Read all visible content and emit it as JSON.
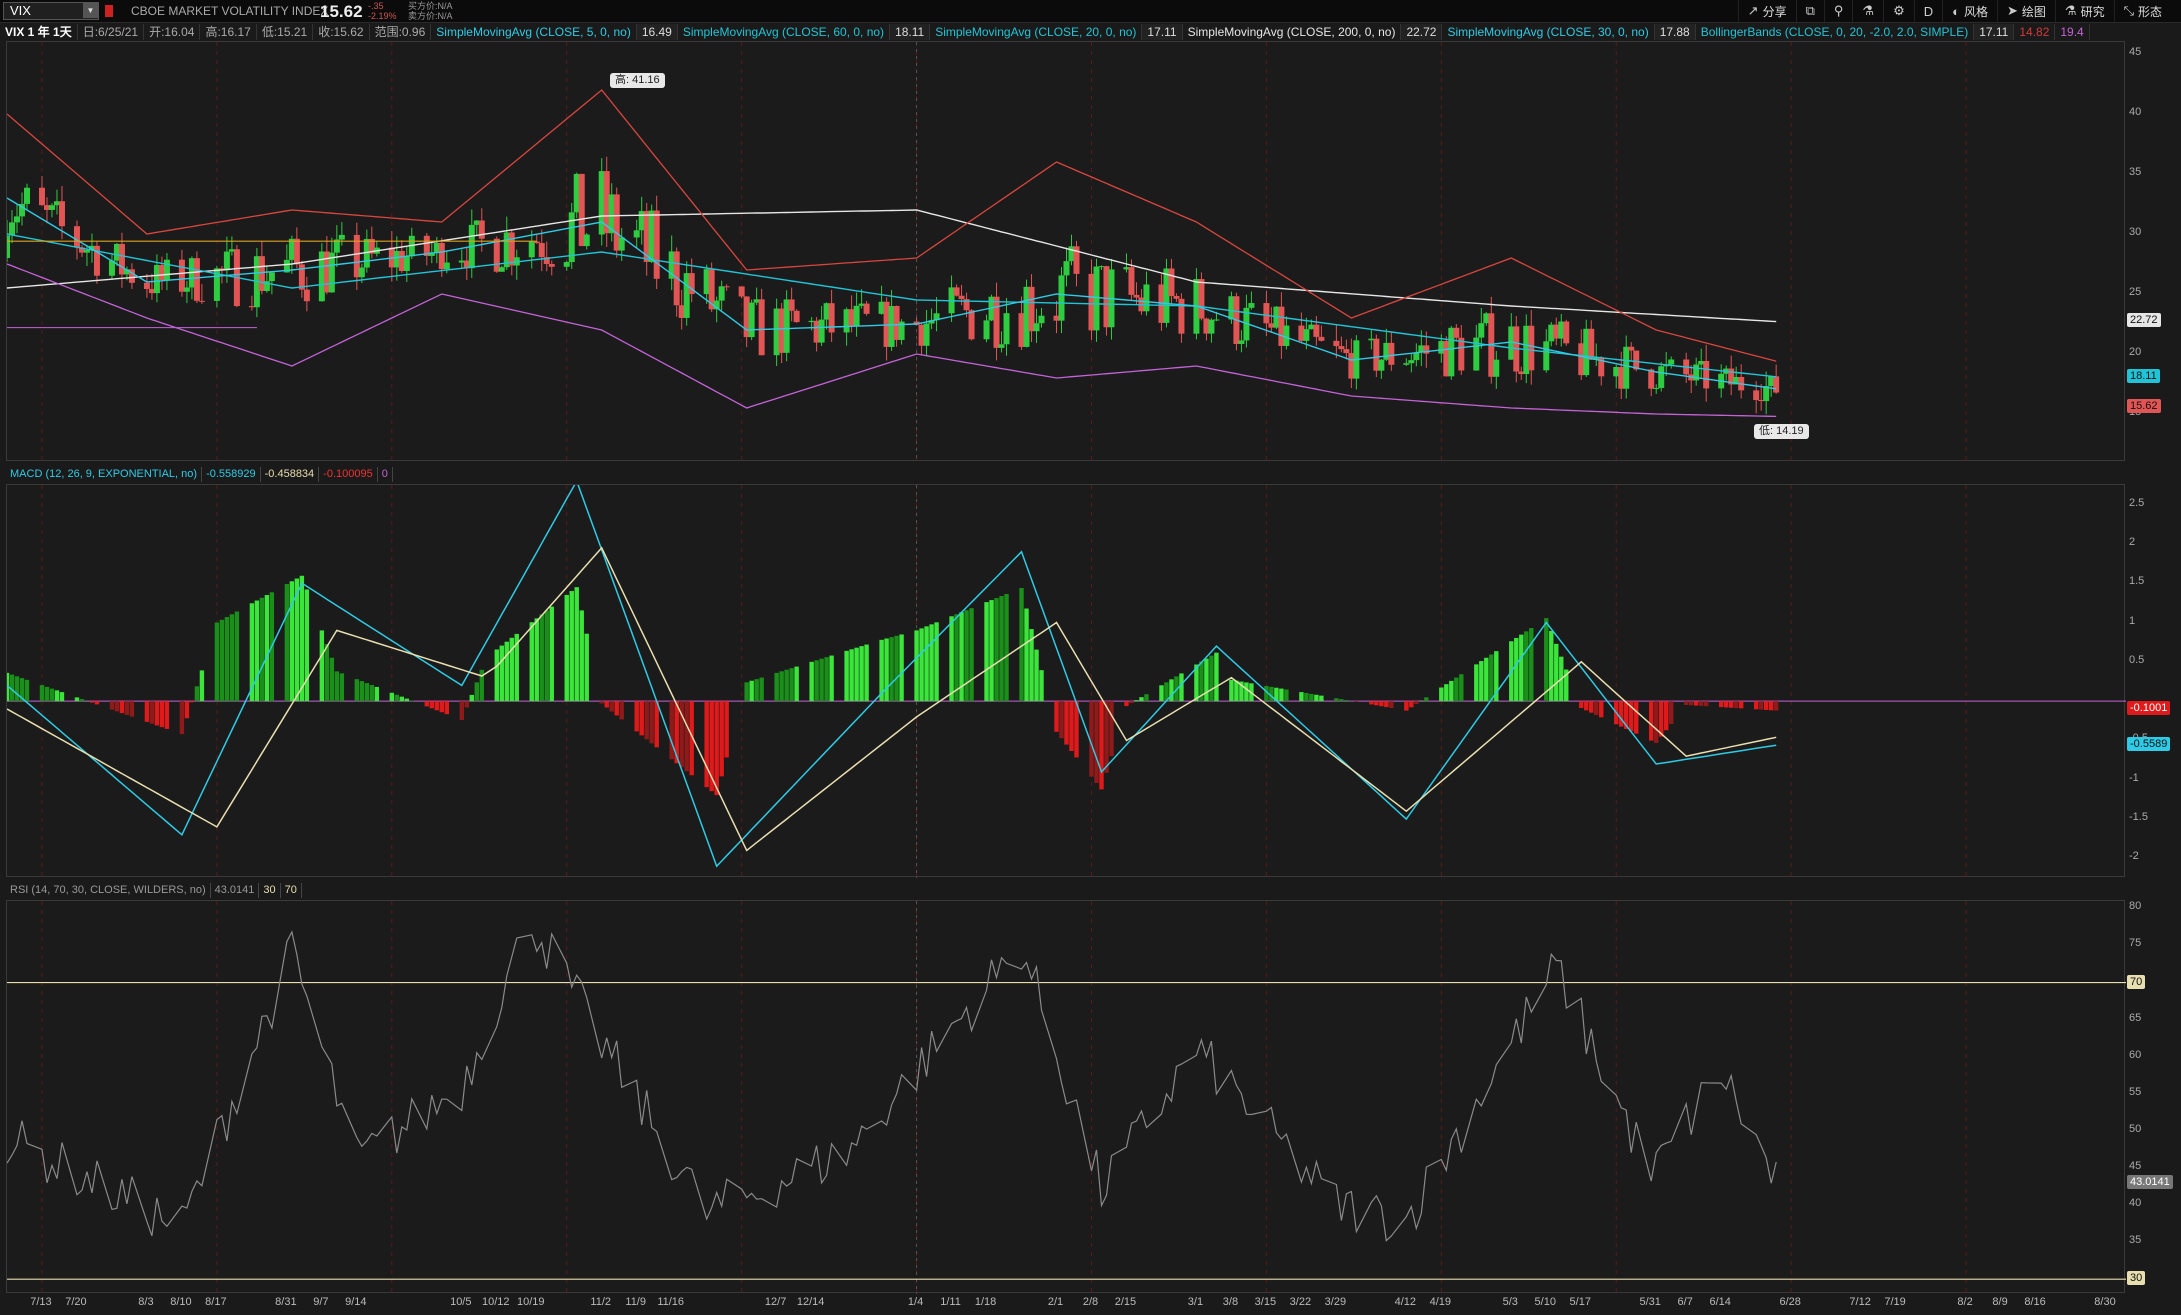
{
  "header": {
    "symbol": "VIX",
    "description": "CBOE MARKET VOLATILITY INDEX",
    "last": "15.62",
    "change": "-.35",
    "change_pct": "-2.19%",
    "bid": "买方价:N/A",
    "ask": "卖方价:N/A"
  },
  "toolbar": [
    {
      "icon": "share-icon",
      "glyph": "↗",
      "label": "分享"
    },
    {
      "icon": "screenshot-icon",
      "glyph": "⧉",
      "label": ""
    },
    {
      "icon": "lab-icon",
      "glyph": "⚲",
      "label": ""
    },
    {
      "icon": "beaker-icon",
      "glyph": "⚗",
      "label": ""
    },
    {
      "icon": "gear-icon",
      "glyph": "⚙",
      "label": ""
    },
    {
      "icon": "timeframe-icon",
      "glyph": "D",
      "label": ""
    },
    {
      "icon": "style-icon",
      "glyph": "◐",
      "label": "风格"
    },
    {
      "icon": "drawing-icon",
      "glyph": "➤",
      "label": "绘图"
    },
    {
      "icon": "studies-icon",
      "glyph": "⚗",
      "label": "研究"
    },
    {
      "icon": "pattern-icon",
      "glyph": "⤡",
      "label": "形态"
    }
  ],
  "info": {
    "period": "VIX 1 年 1天",
    "date": "日:6/25/21",
    "open": "开:16.04",
    "high": "高:16.17",
    "low": "低:15.21",
    "close": "收:15.62",
    "range": "范围:0.96",
    "studies": [
      {
        "label": "SimpleMovingAvg (CLOSE, 5, 0, no)",
        "value": "16.49",
        "color": "#2ecbe6"
      },
      {
        "label": "SimpleMovingAvg (CLOSE, 60, 0, no)",
        "value": "18.11",
        "color": "#21c4d6"
      },
      {
        "label": "SimpleMovingAvg (CLOSE, 20, 0, no)",
        "value": "17.11",
        "color": "#21c4d6"
      },
      {
        "label": "SimpleMovingAvg (CLOSE, 200, 0, no)",
        "value": "22.72",
        "color": "#e6e6e6"
      },
      {
        "label": "SimpleMovingAvg (CLOSE, 30, 0, no)",
        "value": "17.88",
        "color": "#2ecbe6"
      },
      {
        "label": "BollingerBands (CLOSE, 0, 20, -2.0, 2.0, SIMPLE)",
        "value": "17.11",
        "color": "#21c4d6"
      }
    ],
    "bb_lower": "14.82",
    "bb_upper": "19.4"
  },
  "macd_title": {
    "label": "MACD (12, 26, 9, EXPONENTIAL, no)",
    "value": "-0.558929",
    "avg": "-0.458834",
    "diff": "-0.100095",
    "zero": "0"
  },
  "rsi_title": {
    "label": "RSI (14, 70, 30, CLOSE, WILDERS, no)",
    "value": "43.0141",
    "os": "30",
    "ob": "70"
  },
  "price_axis": {
    "ticks": [
      "45",
      "40",
      "35",
      "30",
      "25",
      "20",
      "15"
    ],
    "tags": {
      "sma200": "22.72",
      "sma60": "18.11",
      "last": "15.62"
    },
    "high_bubble": "高: 41.16",
    "low_bubble": "低: 14.19"
  },
  "macd_axis": {
    "ticks": [
      "2.5",
      "2",
      "1.5",
      "1",
      "0.5",
      "-0.5",
      "-1",
      "-1.5",
      "-2"
    ],
    "tags": {
      "diff": "-0.1001",
      "value": "-0.5589"
    }
  },
  "rsi_axis": {
    "ticks": [
      "80",
      "75",
      "65",
      "60",
      "55",
      "50",
      "45",
      "40",
      "35"
    ],
    "tags": {
      "ob": "70",
      "value": "43.0141",
      "os": "30"
    }
  },
  "xaxis": {
    "labels": [
      "7/13",
      "7/20",
      "8/3",
      "8/10",
      "8/17",
      "8/31",
      "9/7",
      "9/14",
      "10/5",
      "10/12",
      "10/19",
      "11/2",
      "11/9",
      "11/16",
      "12/7",
      "12/14",
      "1/4",
      "1/11",
      "1/18",
      "2/1",
      "2/8",
      "2/15",
      "3/1",
      "3/8",
      "3/15",
      "3/22",
      "3/29",
      "4/12",
      "4/19",
      "5/3",
      "5/10",
      "5/17",
      "5/31",
      "6/7",
      "6/14",
      "6/28",
      "7/12",
      "7/19",
      "8/2",
      "8/9",
      "8/16",
      "8/30"
    ]
  },
  "chart_data": [
    {
      "type": "candlestick",
      "title": "VIX",
      "ylim": [
        11,
        46
      ],
      "x_range": [
        "2020-07-06",
        "2021-09-03"
      ],
      "series": [
        {
          "name": "SimpleMovingAvg (CLOSE, 200, 0, no)",
          "x": [
            "2020-07-06",
            "2020-09-01",
            "2020-11-02",
            "2021-01-04",
            "2021-03-01",
            "2021-05-03",
            "2021-06-25"
          ],
          "values": [
            25.5,
            27.5,
            31.5,
            32.0,
            26.0,
            24.0,
            22.7
          ]
        },
        {
          "name": "SimpleMovingAvg (CLOSE, 60, 0, no)",
          "x": [
            "2020-07-06",
            "2020-09-01",
            "2020-11-02",
            "2021-01-04",
            "2021-03-01",
            "2021-05-03",
            "2021-06-25"
          ],
          "values": [
            30.0,
            25.5,
            28.5,
            24.5,
            24.0,
            20.5,
            18.1
          ]
        },
        {
          "name": "SimpleMovingAvg (CLOSE, 20, 0, no)",
          "x": [
            "2020-07-06",
            "2020-08-03",
            "2020-09-01",
            "2020-10-01",
            "2020-11-02",
            "2020-12-01",
            "2021-01-04",
            "2021-02-01",
            "2021-03-01",
            "2021-04-01",
            "2021-05-03",
            "2021-06-01",
            "2021-06-25"
          ],
          "values": [
            33.0,
            26.0,
            27.0,
            28.5,
            31.0,
            22.0,
            22.5,
            25.0,
            24.0,
            19.5,
            21.0,
            18.5,
            17.1
          ]
        },
        {
          "name": "BollingerBands (CLOSE, 0, 20, -2.0, 2.0, SIMPLE)",
          "x": [
            "2020-07-06",
            "2020-08-03",
            "2020-09-01",
            "2020-10-01",
            "2020-11-02",
            "2020-12-01",
            "2021-01-04",
            "2021-02-01",
            "2021-03-01",
            "2021-04-01",
            "2021-05-03",
            "2021-06-01",
            "2021-06-25"
          ],
          "upper": [
            40.0,
            30.0,
            32.0,
            31.0,
            42.0,
            27.0,
            28.0,
            36.0,
            31.0,
            23.0,
            28.0,
            22.0,
            19.4
          ],
          "lower": [
            27.5,
            23.0,
            19.0,
            25.0,
            22.0,
            15.5,
            20.0,
            18.0,
            19.0,
            16.5,
            15.5,
            15.0,
            14.8
          ]
        }
      ],
      "high": 41.16,
      "low": 14.19,
      "last": 15.62
    },
    {
      "type": "line",
      "title": "MACD (12, 26, 9, EXPONENTIAL, no)",
      "ylim": [
        -2.25,
        2.75
      ],
      "series": [
        {
          "name": "Value",
          "x": [
            "2020-07-06",
            "2020-08-10",
            "2020-09-03",
            "2020-10-05",
            "2020-10-28",
            "2020-11-25",
            "2020-12-28",
            "2021-01-25",
            "2021-02-10",
            "2021-03-05",
            "2021-04-12",
            "2021-05-10",
            "2021-06-01",
            "2021-06-25"
          ],
          "values": [
            0.2,
            -1.7,
            1.5,
            0.2,
            2.8,
            -2.1,
            0.1,
            1.9,
            -0.9,
            0.7,
            -1.5,
            1.0,
            -0.8,
            -0.56
          ]
        },
        {
          "name": "Avg",
          "x": [
            "2020-07-06",
            "2020-08-17",
            "2020-09-10",
            "2020-10-10",
            "2020-11-02",
            "2020-12-01",
            "2021-01-04",
            "2021-02-01",
            "2021-02-15",
            "2021-03-08",
            "2021-04-12",
            "2021-05-17",
            "2021-06-07",
            "2021-06-25"
          ],
          "values": [
            -0.1,
            -1.6,
            0.9,
            0.3,
            1.95,
            -1.9,
            -0.2,
            1.0,
            -0.5,
            0.3,
            -1.4,
            0.5,
            -0.7,
            -0.46
          ]
        },
        {
          "name": "Diff",
          "last": -0.1
        }
      ]
    },
    {
      "type": "line",
      "title": "RSI (14, 70, 30, CLOSE, WILDERS, no)",
      "ylim": [
        28,
        81
      ],
      "overbought": 70,
      "oversold": 30,
      "series": [
        {
          "name": "RSI",
          "x": [
            "2020-07-06",
            "2020-08-10",
            "2020-09-01",
            "2020-09-14",
            "2020-10-05",
            "2020-10-19",
            "2020-11-02",
            "2020-11-23",
            "2020-12-21",
            "2021-01-25",
            "2021-02-10",
            "2021-03-01",
            "2021-03-29",
            "2021-04-12",
            "2021-05-12",
            "2021-05-31",
            "2021-06-14",
            "2021-06-25"
          ],
          "values": [
            49,
            37,
            74,
            46,
            56,
            78.5,
            62,
            39,
            47,
            75,
            42,
            61,
            40,
            38,
            72,
            44,
            58,
            43.0
          ]
        }
      ]
    }
  ]
}
